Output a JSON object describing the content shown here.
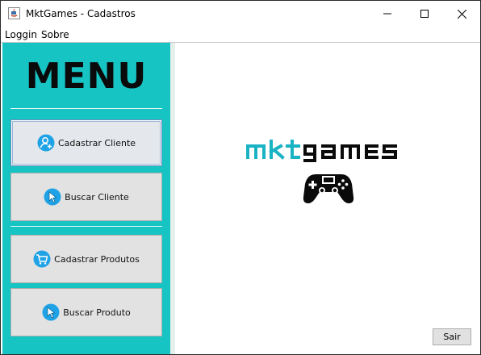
{
  "window": {
    "title": "MktGames - Cadastros"
  },
  "menubar": {
    "items": [
      {
        "label": "Loggin"
      },
      {
        "label": "Sobre"
      }
    ]
  },
  "sidebar": {
    "title": "MENU",
    "buttons": [
      {
        "label": "Cadastrar Cliente",
        "icon": "add-user-icon"
      },
      {
        "label": "Buscar Cliente",
        "icon": "pointer-icon"
      },
      {
        "label": "Cadastrar Produtos",
        "icon": "cart-icon"
      },
      {
        "label": "Buscar Produto",
        "icon": "pointer-icon"
      }
    ]
  },
  "main": {
    "logo_text": "mktgames",
    "exit_label": "Sair"
  },
  "colors": {
    "sidebar": "#17c4c4",
    "icon_blue": "#1fa3e6",
    "logo_teal": "#1ab3c4"
  }
}
